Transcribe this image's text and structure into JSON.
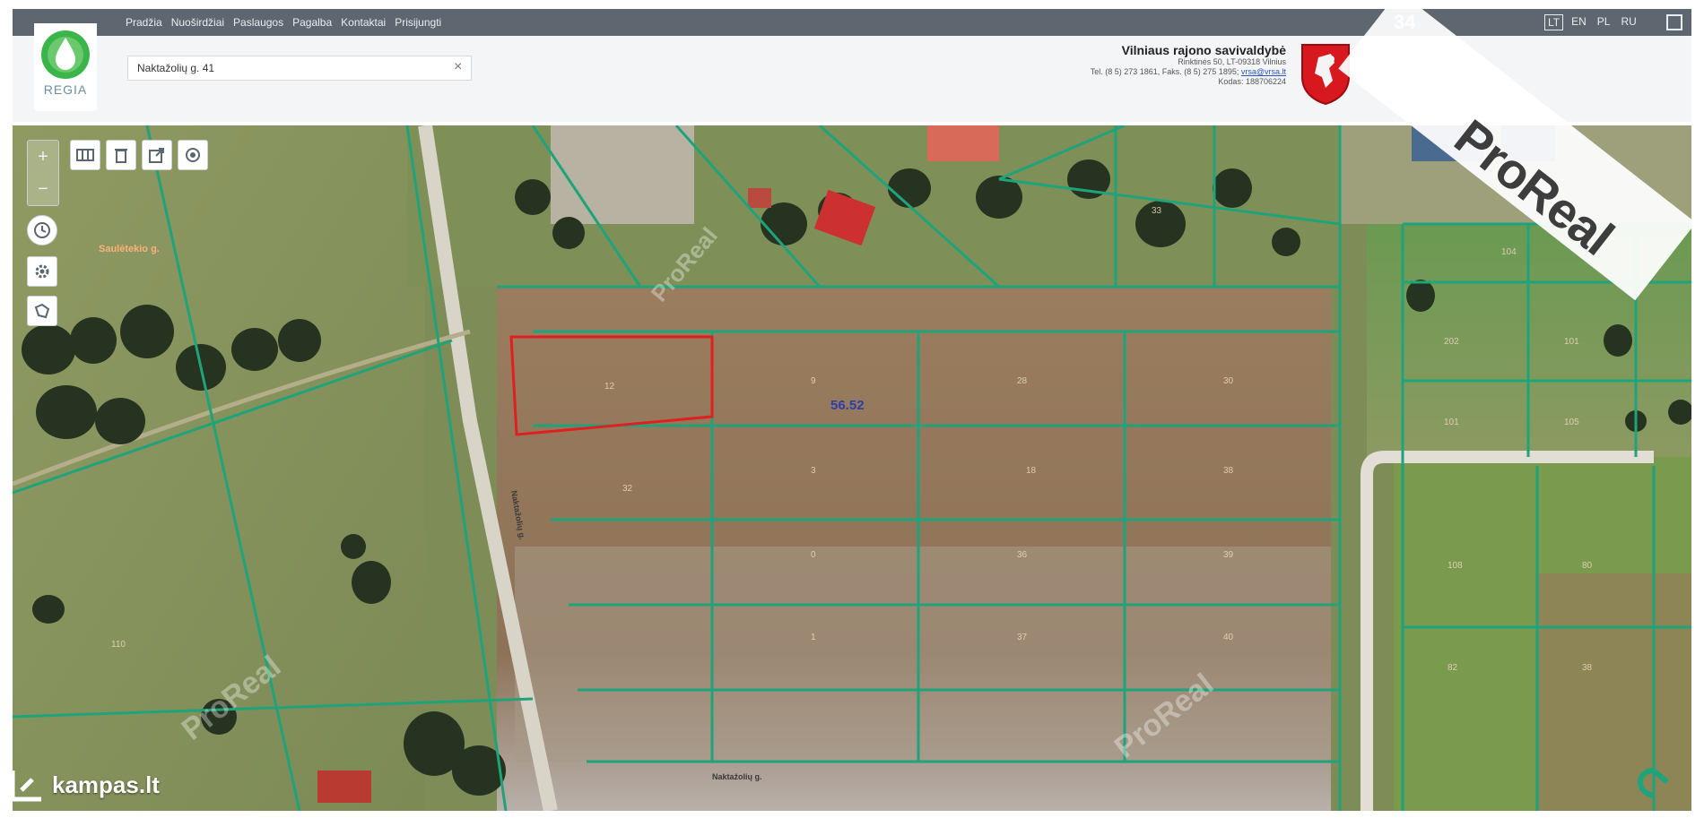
{
  "nav": {
    "menu": [
      "Pradžia",
      "Nuoširdžiai",
      "Paslaugos",
      "Pagalba",
      "Kontaktai",
      "Prisijungti"
    ],
    "coordinates": "34",
    "languages": [
      "LT",
      "EN",
      "PL",
      "RU"
    ],
    "active_language": "LT"
  },
  "logo": {
    "text": "REGIA"
  },
  "search": {
    "value": "Naktažolių g. 41"
  },
  "municipality": {
    "title": "Vilniaus rajono savivaldybė",
    "address": "Rinktinės 50, LT-09318 Vilnius",
    "phone_prefix": "Tel. (8 5) 273 1861, Faks. (8 5) 275 1895; ",
    "email": "vrsa@vrsa.lt",
    "code": "Kodas: 188706224"
  },
  "map": {
    "area_label": "56.52",
    "street_label_top": "Saulėtekio g.",
    "street_label_side": "Naktažolių g.",
    "street_label_bottom": "Naktažolių g.",
    "plot_numbers": [
      "12",
      "9",
      "28",
      "30",
      "32",
      "3",
      "18",
      "38",
      "0",
      "36",
      "39",
      "1",
      "37",
      "40",
      "202",
      "101",
      "101",
      "105",
      "108",
      "80",
      "82",
      "38",
      "104",
      "110",
      "33"
    ]
  },
  "controls": {
    "zoom_in": "+",
    "zoom_out": "−"
  },
  "watermarks": {
    "proreal_banner": "ProReal",
    "proreal_map": "ProReal",
    "kampas": "kampas.lt"
  },
  "colors": {
    "nav_bg": "#5e6770",
    "parcel_lines": "#1fa37a",
    "selection": "#e02020",
    "crest_red": "#d8181f"
  }
}
